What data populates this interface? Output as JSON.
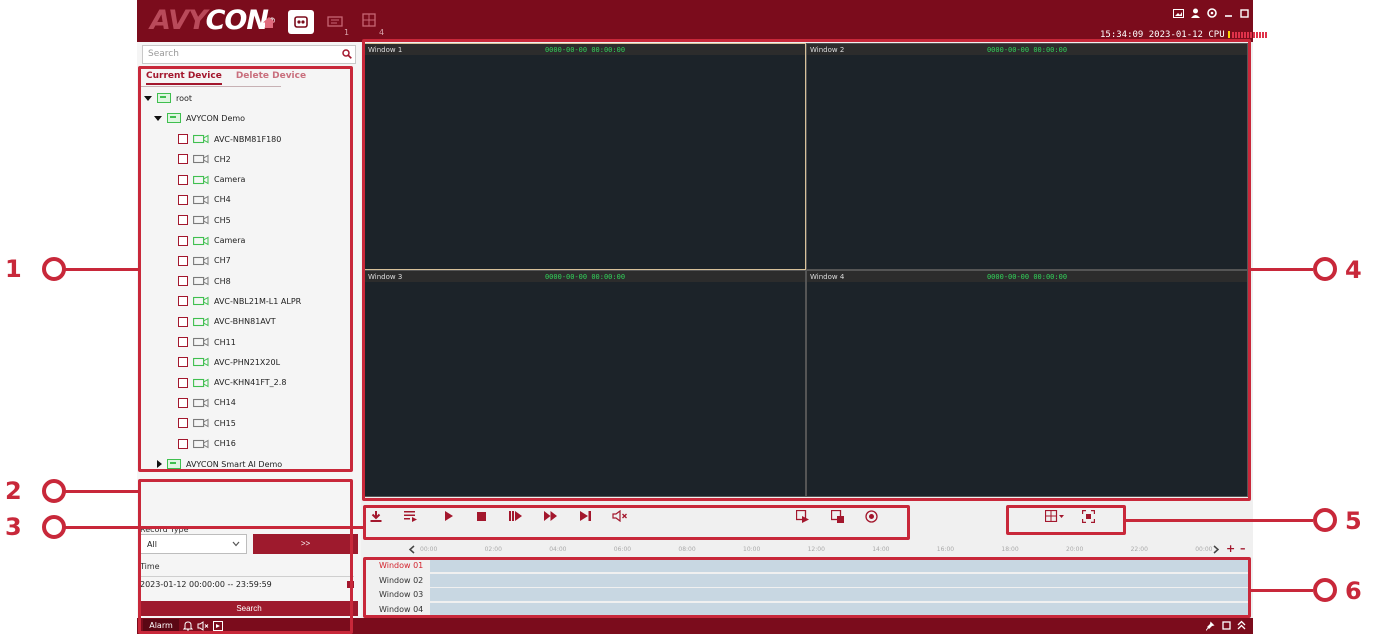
{
  "app": {
    "logo": {
      "prefix": "AVY",
      "suffix": "CON",
      "registered": "®"
    },
    "tab_counts": [
      "1",
      "4"
    ],
    "status": {
      "clock": "15:34:09 2023-01-12",
      "cpu_label": "CPU"
    }
  },
  "left_panel": {
    "search_placeholder": "Search",
    "tabs": [
      "Current Device",
      "Delete Device"
    ],
    "tree": {
      "root": "root",
      "group": "AVYCON Demo",
      "channels": [
        "AVC-NBM81F180",
        "CH2",
        "Camera",
        "CH4",
        "CH5",
        "Camera",
        "CH7",
        "CH8",
        "AVC-NBL21M-L1 ALPR",
        "AVC-BHN81AVT",
        "CH11",
        "AVC-PHN21X20L",
        "AVC-KHN41FT_2.8",
        "CH14",
        "CH15",
        "CH16"
      ],
      "online": [
        true,
        false,
        true,
        false,
        false,
        true,
        false,
        false,
        true,
        true,
        false,
        true,
        true,
        false,
        false,
        false
      ],
      "group2": "AVYCON Smart AI Demo"
    },
    "record_type_label": "Record Type",
    "record_type_value": "All",
    "go_label": ">>",
    "time_label": "Time",
    "time_value": "2023-01-12 00:00:00 -- 23:59:59",
    "search_button": "Search"
  },
  "video": {
    "windows": [
      {
        "title": "Window 1",
        "time": "0000-00-00 00:00:00"
      },
      {
        "title": "Window 2",
        "time": "0000-00-00 00:00:00"
      },
      {
        "title": "Window 3",
        "time": "0000-00-00 00:00:00"
      },
      {
        "title": "Window 4",
        "time": "0000-00-00 00:00:00"
      }
    ]
  },
  "timeline": {
    "ticks": [
      "00:00",
      "02:00",
      "04:00",
      "06:00",
      "08:00",
      "10:00",
      "12:00",
      "14:00",
      "16:00",
      "18:00",
      "20:00",
      "22:00",
      "00:00"
    ],
    "rows": [
      "Window 01",
      "Window 02",
      "Window 03",
      "Window 04"
    ],
    "zoom_in": "+",
    "zoom_out": "–"
  },
  "bottom_bar": {
    "alarm": "Alarm"
  },
  "annotations": [
    "1",
    "2",
    "3",
    "4",
    "5",
    "6"
  ],
  "colors": {
    "brand": "#7b0c1c",
    "accent": "#a3172d",
    "annotation": "#c8283a",
    "timecode": "#32d35a"
  }
}
